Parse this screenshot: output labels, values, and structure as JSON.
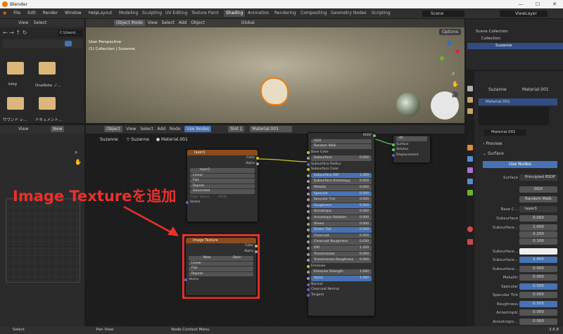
{
  "window": {
    "title": "Blender"
  },
  "menu": [
    "File",
    "Edit",
    "Render",
    "Window",
    "Help"
  ],
  "workspace_tabs": [
    "Layout",
    "Modeling",
    "Sculpting",
    "UV Editing",
    "Texture Paint",
    "Shading",
    "Animation",
    "Rendering",
    "Compositing",
    "Geometry Nodes",
    "Scripting"
  ],
  "active_tab": "Shading",
  "scene": "Scene",
  "view_layer": "ViewLayer",
  "file_browser": {
    "header": [
      "View",
      "Select"
    ],
    "path": "C:\\Users\\",
    "folders": [
      {
        "label": "blog"
      },
      {
        "label": "OneNote ノ..."
      },
      {
        "label": "サウンド レ..."
      },
      {
        "label": "ドキュメント..."
      }
    ]
  },
  "image_editor": {
    "view": "View",
    "new": "New"
  },
  "viewport": {
    "mode": "Object Mode",
    "menu": [
      "View",
      "Select",
      "Add",
      "Object"
    ],
    "transform": "Global",
    "options": "Options",
    "info1": "User Perspective",
    "info2": "(1) Collection | Suzanne"
  },
  "outliner": {
    "scene_collection": "Scene Collection",
    "collection": "Collection",
    "object": "Suzanne"
  },
  "node_editor": {
    "type": "Object",
    "menu": [
      "View",
      "Select",
      "Add",
      "Node"
    ],
    "use_nodes": "Use Nodes",
    "slot": "Slot 1",
    "material": "Material.001",
    "breadcrumb": [
      "Suzanne",
      "Suzanne",
      "Material.001"
    ]
  },
  "annotation": "Image Textureを追加",
  "node_layer": {
    "title": "layer1",
    "out_color": "Color",
    "out_alpha": "Alpha",
    "image": "layer1",
    "interp": "Linear",
    "proj": "Flat",
    "ext": "Repeat",
    "source": "Generated",
    "colorspace": "Color Space",
    "colorspace_val": "sRGB",
    "vector": "Vector"
  },
  "node_image": {
    "title": "Image Texture",
    "out_color": "Color",
    "out_alpha": "Alpha",
    "new": "New",
    "open": "Open",
    "interp": "Linear",
    "proj": "Flat",
    "ext": "Repeat",
    "vector": "Vector"
  },
  "node_bsdf": {
    "title": "BSDF",
    "dist": "GGX",
    "sss": "Random Walk",
    "rows": [
      [
        "Base Color",
        ""
      ],
      [
        "Subsurface",
        "0.000"
      ],
      [
        "Subsurface Radius",
        ""
      ],
      [
        "Subsurface Color",
        ""
      ],
      [
        "Subsurface IOR",
        "1.400"
      ],
      [
        "Subsurface Anisotropy",
        "0.000"
      ],
      [
        "Metallic",
        "0.000"
      ],
      [
        "Specular",
        "0.500"
      ],
      [
        "Specular Tint",
        "0.000"
      ],
      [
        "Roughness",
        "0.500"
      ],
      [
        "Anisotropic",
        "0.000"
      ],
      [
        "Anisotropic Rotation",
        "0.000"
      ],
      [
        "Sheen",
        "0.000"
      ],
      [
        "Sheen Tint",
        "0.500"
      ],
      [
        "Clearcoat",
        "0.000"
      ],
      [
        "Clearcoat Roughness",
        "0.030"
      ],
      [
        "IOR",
        "1.450"
      ],
      [
        "Transmission",
        "0.000"
      ],
      [
        "Transmission Roughness",
        "0.000"
      ],
      [
        "Emission",
        ""
      ],
      [
        "Emission Strength",
        "1.000"
      ],
      [
        "Alpha",
        "1.000"
      ],
      [
        "Normal",
        ""
      ],
      [
        "Clearcoat Normal",
        ""
      ],
      [
        "Tangent",
        ""
      ]
    ]
  },
  "node_output": {
    "target": "All",
    "surface": "Surface",
    "volume": "Volume",
    "displacement": "Displacement"
  },
  "properties": {
    "object": "Suzanne",
    "material": "Material.001",
    "slot": "Material.001",
    "mat_name": "Material.001",
    "preview": "Preview",
    "surface_section": "Surface",
    "use_nodes": "Use Nodes",
    "surface_label": "Surface",
    "surface_val": "Principled BSDF",
    "dist": "GGX",
    "sss": "Random Walk",
    "base_color_label": "Base C...",
    "base_color_val": "layer1",
    "rows": [
      [
        "Subsurface",
        "0.000"
      ],
      [
        "Subsurface...",
        "1.000"
      ],
      [
        "",
        "0.200"
      ],
      [
        "",
        "0.100"
      ],
      [
        "Subsurface...",
        ""
      ],
      [
        "Subsurface...",
        "1.400"
      ],
      [
        "Subsurface...",
        "0.000"
      ],
      [
        "Metallic",
        "0.000"
      ],
      [
        "Specular",
        "0.500"
      ],
      [
        "Specular Tint",
        "0.000"
      ],
      [
        "Roughness",
        "0.500"
      ],
      [
        "Anisotropic",
        "0.000"
      ],
      [
        "Anisotropic...",
        "0.000"
      ]
    ]
  },
  "statusbar": {
    "select": "Select",
    "pan": "Pan View",
    "context": "Node Context Menu",
    "version": "3.6.8"
  },
  "colors": {
    "accent": "#4772b3",
    "annotation": "#e8312d",
    "orange": "#e87d0d"
  }
}
